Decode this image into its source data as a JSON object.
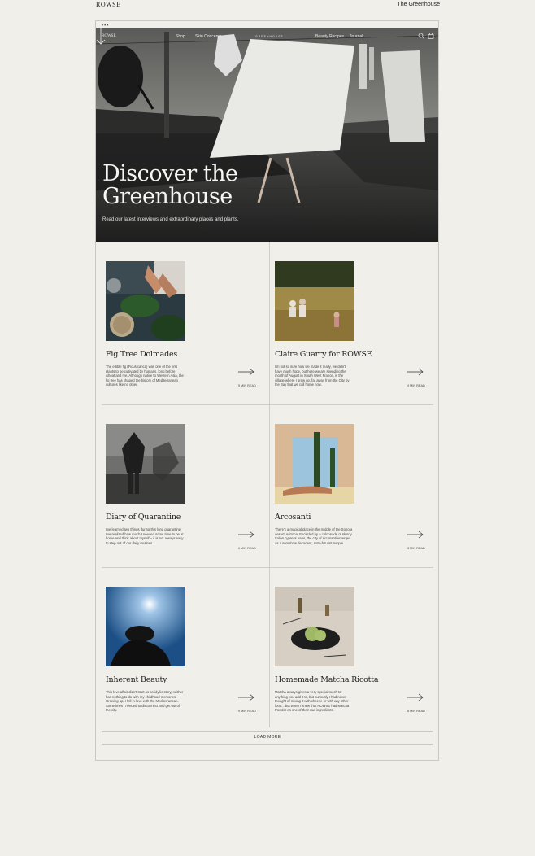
{
  "brand": "ROWSE",
  "page_name": "The Greenhouse",
  "browser": {
    "dots": "•••"
  },
  "nav": {
    "brand": "ROWSE",
    "items": [
      "Shop",
      "Skin Concerns",
      "Beauty Recipes",
      "Journal"
    ],
    "center_logo": "GREENHOUSE"
  },
  "hero": {
    "title_line1": "Discover the",
    "title_line2": "Greenhouse",
    "subtitle": "Read our latest interviews and extraordinary places and plants."
  },
  "articles": [
    {
      "title": "Fig Tree Dolmades",
      "excerpt": "The edible fig (Ficus carica) was one of the first plants to be cultivated by humans, long before wheat and rye. Although native to Western Asia, the fig tree has shaped the history of Mediterranean cultures like no other.",
      "read_time": "5 MIN READ"
    },
    {
      "title": "Claire Guarry for ROWSE",
      "excerpt": "I'm not so sure how we made it really, we didn't have much hope, but here we are spending the month of August in South West France, in the village where I grew up, far away from the City by the Bay that we call home now.",
      "read_time": "4 MIN READ"
    },
    {
      "title": "Diary of Quarantine",
      "excerpt": "I've learned two things during this long quarantine. I've realized how much I needed some time to be at home and think about myself – it is not always easy to step out of our daily routines.",
      "read_time": "6 MIN READ"
    },
    {
      "title": "Arcosanti",
      "excerpt": "There's a magical place in the middle of the Sonora desert, Arizona. Encircled by a colonnade of skinny Italian cypress trees, the city of Arcosanti emerges as a somehow decadent, retro-futurist temple.",
      "read_time": "3 MIN READ"
    },
    {
      "title": "Inherent Beauty",
      "excerpt": "This love affair didn't start as an idyllic story, neither has nothing to do with my childhood memories. Growing up, I fell in love with the Mediterranean. Sometimes I needed to disconnect and get out of the city.",
      "read_time": "9 MIN READ"
    },
    {
      "title": "Homemade Matcha Ricotta",
      "excerpt": "Matcha always gives a very special touch to anything you add it to, but curiously I had never thought of mixing it with cheese or with any other food... but when I knew that ROWSE had Matcha Powder as one of their raw ingredients.",
      "read_time": "8 MIN READ"
    }
  ],
  "load_more": "LOAD MORE"
}
